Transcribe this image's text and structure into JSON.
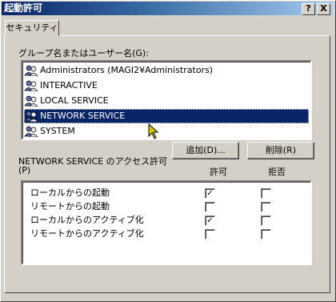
{
  "window": {
    "title": "起動許可",
    "help_label": "?",
    "close_label": "X"
  },
  "tab": {
    "label": "セキュリティ"
  },
  "groups": {
    "label": "グループ名またはユーザー名(G):",
    "items": [
      {
        "label": "Administrators (MAGI2¥Administrators)",
        "icon": "user-group-icon",
        "selected": false
      },
      {
        "label": "INTERACTIVE",
        "icon": "user-group-icon",
        "selected": false
      },
      {
        "label": "LOCAL SERVICE",
        "icon": "user-group-icon",
        "selected": false
      },
      {
        "label": "NETWORK SERVICE",
        "icon": "user-group-icon",
        "selected": true
      },
      {
        "label": "SYSTEM",
        "icon": "user-group-icon",
        "selected": false
      }
    ]
  },
  "buttons": {
    "add": "追加(D)...",
    "remove": "削除(R)"
  },
  "permissions": {
    "label_line1": "NETWORK SERVICE のアクセス許可",
    "label_line2": "(P)",
    "allow_header": "許可",
    "deny_header": "拒否",
    "rows": [
      {
        "name": "ローカルからの起動",
        "allow": true,
        "deny": false
      },
      {
        "name": "リモートからの起動",
        "allow": false,
        "deny": false
      },
      {
        "name": "ローカルからのアクティブ化",
        "allow": true,
        "deny": false
      },
      {
        "name": "リモートからのアクティブ化",
        "allow": false,
        "deny": false
      }
    ]
  },
  "colors": {
    "selection": "#0a246a",
    "titlebar": "#0a246a",
    "face": "#d4d0c8"
  }
}
